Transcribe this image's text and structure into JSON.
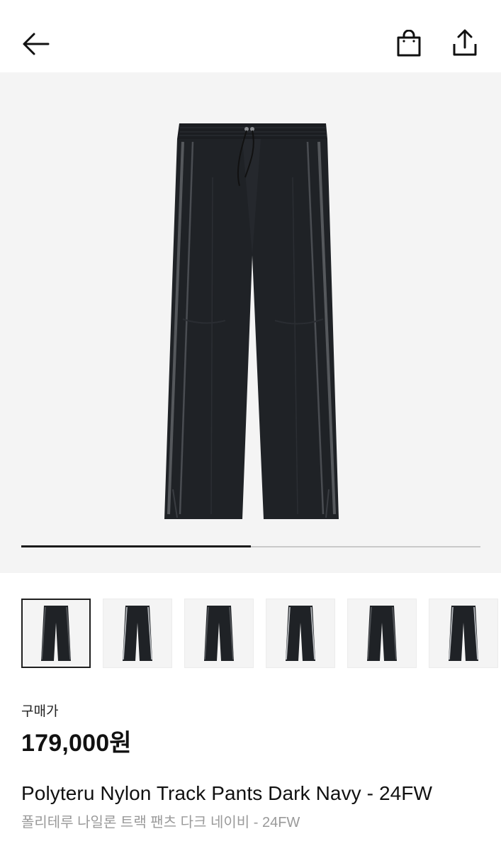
{
  "header": {
    "back_icon": "arrow-left-icon",
    "bag_icon": "shopping-bag-icon",
    "share_icon": "share-upload-icon"
  },
  "gallery": {
    "current_index": 1,
    "image_count": 2,
    "progress_fraction": 0.5,
    "thumbnails": [
      {
        "active": true
      },
      {
        "active": false
      },
      {
        "active": false
      },
      {
        "active": false
      },
      {
        "active": false
      },
      {
        "active": false
      }
    ]
  },
  "product": {
    "price_label": "구매가",
    "price": "179,000원",
    "title_en": "Polyteru Nylon Track Pants Dark Navy - 24FW",
    "title_ko": "폴리테루 나일론 트랙 팬츠 다크 네이비 - 24FW"
  },
  "colors": {
    "pants": "#1f2226",
    "stripe": "#55585c",
    "hero_bg": "#f4f4f4",
    "progress_fill": "#1b1b1b",
    "progress_track": "#c9c9c9",
    "muted_text": "#9a9a9a"
  }
}
